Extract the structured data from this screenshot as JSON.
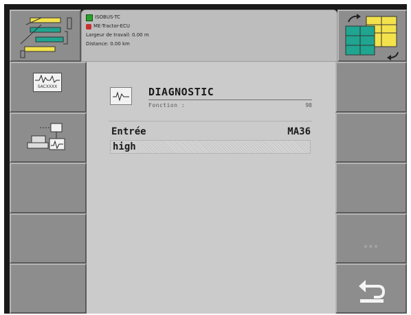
{
  "header": {
    "connection": "ISOBUS-TC",
    "ecu": "ME-Tractor-ECU",
    "working_width": "Largeur de travail: 0.00  m",
    "distance": "Distance: 0.00 km"
  },
  "softkeys_left": [
    {
      "name": "diagnostic-softkey",
      "label": "SACXXXX"
    },
    {
      "name": "io-test-softkey"
    },
    {
      "name": "empty-softkey-3"
    },
    {
      "name": "empty-softkey-4"
    },
    {
      "name": "empty-softkey-5"
    }
  ],
  "softkeys_right": [
    {
      "name": "empty-softkey-r1"
    },
    {
      "name": "empty-softkey-r2"
    },
    {
      "name": "empty-softkey-r3"
    },
    {
      "name": "more-softkey",
      "label": "◦◦◦"
    },
    {
      "name": "back-softkey"
    }
  ],
  "main": {
    "title": "DIAGNOSTIC",
    "function_label": "Fonction   :",
    "function_value": "98",
    "entry_label": "Entrée",
    "entry_value": "MA36",
    "value": "high"
  },
  "colors": {
    "softkey": "#8d8d8d",
    "panel": "#cbcbcb",
    "header": "#bdbdbd",
    "accent_yellow": "#f3e24c",
    "accent_teal": "#1fa590"
  }
}
